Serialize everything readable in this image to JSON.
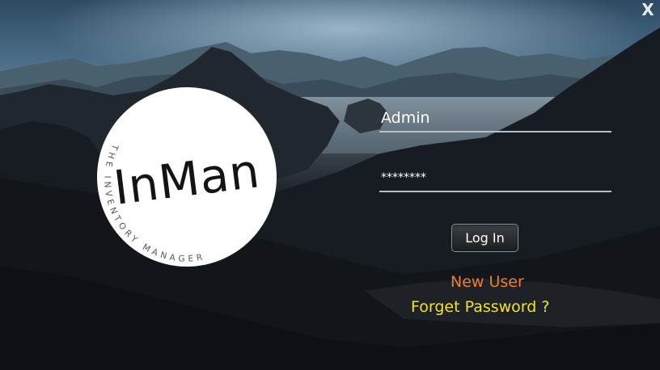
{
  "window": {
    "close_label": "X"
  },
  "logo": {
    "wordmark": "InMan",
    "tagline": "THE INVENTORY MANAGER"
  },
  "login_form": {
    "username_value": "Admin",
    "password_value": "********",
    "login_button_label": "Log In"
  },
  "links": {
    "new_user": "New User",
    "forgot_password": "Forget Password ?"
  },
  "colors": {
    "new_user_link": "#ef7c28",
    "forgot_password_link": "#f4e21d",
    "logo_background": "#ffffff"
  },
  "icons": {
    "close": "close-icon"
  }
}
